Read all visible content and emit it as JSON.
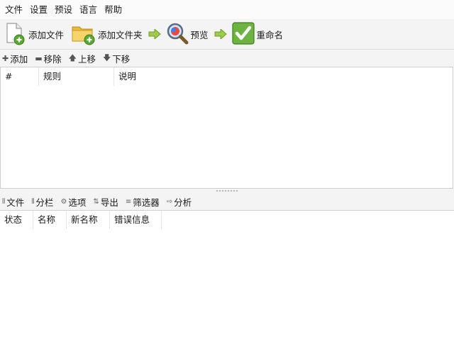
{
  "menu": [
    "文件",
    "设置",
    "预设",
    "语言",
    "帮助"
  ],
  "toolbar": {
    "add_file": "添加文件",
    "add_folder": "添加文件夹",
    "preview": "预览",
    "rename": "重命名"
  },
  "rules_toolbar": {
    "add": "添加",
    "remove": "移除",
    "move_up": "上移",
    "move_down": "下移"
  },
  "rules_table": {
    "columns": [
      "#",
      "规则",
      "说明"
    ]
  },
  "tabs": {
    "files": "文件",
    "columns": "分栏",
    "options": "选项",
    "export": "导出",
    "filter": "筛选器",
    "analyze": "分析"
  },
  "files_table": {
    "columns": [
      "状态",
      "名称",
      "新名称",
      "错误信息"
    ]
  },
  "colors": {
    "toolbar_bg": "#f4f4f4",
    "menubar_bg": "#fbfbfb",
    "accent_green": "#6db33f",
    "folder_yellow": "#f2c94c"
  }
}
